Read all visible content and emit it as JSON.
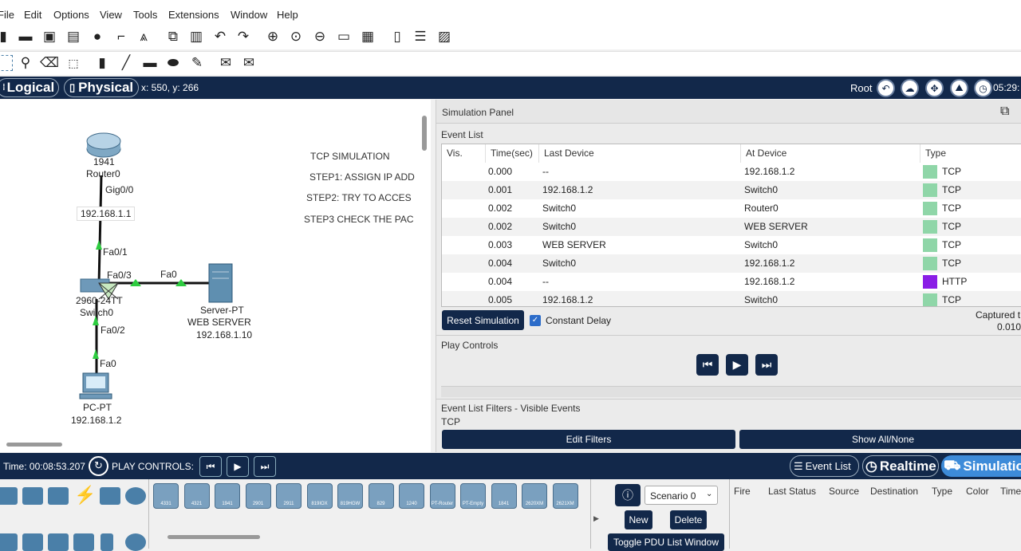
{
  "menu": [
    "File",
    "Edit",
    "Options",
    "View",
    "Tools",
    "Extensions",
    "Window",
    "Help"
  ],
  "modebar": {
    "logical": "Logical",
    "physical": "Physical",
    "coords": "x: 550, y: 266",
    "root": "Root",
    "time": "05:29:"
  },
  "workspace": {
    "router": {
      "model": "1941",
      "name": "Router0",
      "port": "Gig0/0",
      "ip": "192.168.1.1"
    },
    "switch": {
      "model": "2960-24TT",
      "name": "Switch0",
      "p1": "Fa0/1",
      "p3": "Fa0/3",
      "p2": "Fa0/2"
    },
    "server": {
      "link": "Fa0",
      "type": "Server-PT",
      "name": "WEB SERVER",
      "ip": "192.168.1.10"
    },
    "pc": {
      "port": "Fa0",
      "type": "PC-PT",
      "ip": "192.168.1.2"
    },
    "notes": [
      "TCP SIMULATION",
      "STEP1: ASSIGN IP ADD",
      "STEP2: TRY TO ACCES",
      "STEP3 CHECK THE PAC"
    ]
  },
  "sim": {
    "title": "Simulation Panel",
    "event_list_label": "Event List",
    "columns": [
      "Vis.",
      "Time(sec)",
      "Last Device",
      "At Device",
      "Type"
    ],
    "events": [
      {
        "time": "0.000",
        "last": "--",
        "at": "192.168.1.2",
        "type": "TCP",
        "color": "#8fd6a8"
      },
      {
        "time": "0.001",
        "last": "192.168.1.2",
        "at": "Switch0",
        "type": "TCP",
        "color": "#8fd6a8"
      },
      {
        "time": "0.002",
        "last": "Switch0",
        "at": "Router0",
        "type": "TCP",
        "color": "#8fd6a8"
      },
      {
        "time": "0.002",
        "last": "Switch0",
        "at": "WEB SERVER",
        "type": "TCP",
        "color": "#8fd6a8"
      },
      {
        "time": "0.003",
        "last": "WEB SERVER",
        "at": "Switch0",
        "type": "TCP",
        "color": "#8fd6a8"
      },
      {
        "time": "0.004",
        "last": "Switch0",
        "at": "192.168.1.2",
        "type": "TCP",
        "color": "#8fd6a8"
      },
      {
        "time": "0.004",
        "last": "--",
        "at": "192.168.1.2",
        "type": "HTTP",
        "color": "#8a1ee6"
      },
      {
        "time": "0.005",
        "last": "192.168.1.2",
        "at": "Switch0",
        "type": "TCP",
        "color": "#8fd6a8"
      }
    ],
    "reset": "Reset Simulation",
    "constant_delay": "Constant Delay",
    "captured": "Captured t",
    "captured_val": "0.010",
    "play_controls": "Play Controls",
    "filters_label": "Event List Filters - Visible Events",
    "filters_value": "TCP",
    "edit_filters": "Edit Filters",
    "show_all": "Show All/None"
  },
  "bottom": {
    "time": "Time: 00:08:53.207",
    "play_controls": "PLAY CONTROLS:",
    "event_list": "Event List",
    "realtime": "Realtime",
    "simulation": "Simulatio"
  },
  "devices": [
    "4331",
    "4321",
    "1941",
    "2901",
    "2911",
    "819IOX",
    "819HGW",
    "829",
    "1240",
    "PT-Router",
    "PT-Empty",
    "1841",
    "2620XM",
    "2621XM"
  ],
  "pdu": {
    "scenario": "Scenario 0",
    "new": "New",
    "delete": "Delete",
    "toggle": "Toggle PDU List Window",
    "columns": [
      "Fire",
      "Last Status",
      "Source",
      "Destination",
      "Type",
      "Color",
      "Time"
    ]
  }
}
